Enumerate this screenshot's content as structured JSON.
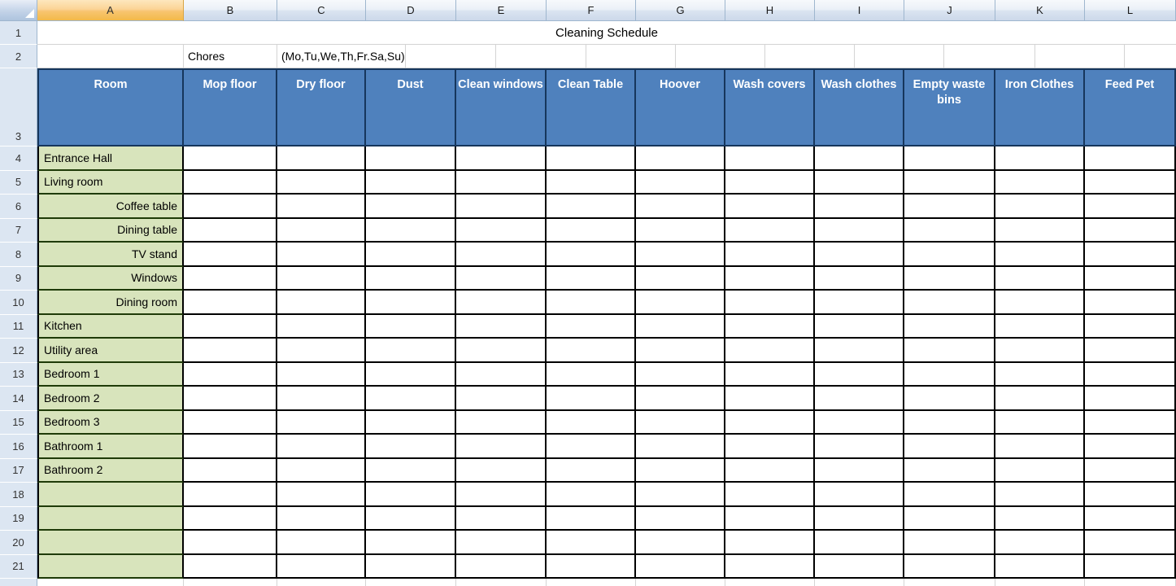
{
  "app": {
    "type": "spreadsheet"
  },
  "columns": {
    "labels": [
      "A",
      "B",
      "C",
      "D",
      "E",
      "F",
      "G",
      "H",
      "I",
      "J",
      "K",
      "L"
    ],
    "selected": "A"
  },
  "rows": {
    "numbers": [
      "1",
      "2",
      "3",
      "4",
      "5",
      "6",
      "7",
      "8",
      "9",
      "10",
      "11",
      "12",
      "13",
      "14",
      "15",
      "16",
      "17",
      "18",
      "19",
      "20",
      "21"
    ]
  },
  "title": {
    "text": "Cleaning Schedule"
  },
  "row2": {
    "b": "Chores",
    "c": "(Mo,Tu,We,Th,Fr.Sa,Su)"
  },
  "header": {
    "room_label": "Room",
    "chores": [
      "Mop floor",
      "Dry floor",
      "Dust",
      "Clean windows",
      "Clean Table",
      "Hoover",
      "Wash covers",
      "Wash clothes",
      "Empty waste bins",
      "Iron Clothes",
      "Feed Pet"
    ]
  },
  "rooms": [
    {
      "row": "4",
      "label": "Entrance Hall",
      "align": "left"
    },
    {
      "row": "5",
      "label": "Living room",
      "align": "left"
    },
    {
      "row": "6",
      "label": "Coffee table",
      "align": "right"
    },
    {
      "row": "7",
      "label": "Dining table",
      "align": "right"
    },
    {
      "row": "8",
      "label": "TV stand",
      "align": "right"
    },
    {
      "row": "9",
      "label": "Windows",
      "align": "right"
    },
    {
      "row": "10",
      "label": "Dining room",
      "align": "right"
    },
    {
      "row": "11",
      "label": "Kitchen",
      "align": "left"
    },
    {
      "row": "12",
      "label": "Utility area",
      "align": "left"
    },
    {
      "row": "13",
      "label": "Bedroom 1",
      "align": "left"
    },
    {
      "row": "14",
      "label": "Bedroom 2",
      "align": "left"
    },
    {
      "row": "15",
      "label": "Bedroom 3",
      "align": "left"
    },
    {
      "row": "16",
      "label": "Bathroom 1",
      "align": "left"
    },
    {
      "row": "17",
      "label": "Bathroom 2",
      "align": "left"
    },
    {
      "row": "18",
      "label": "",
      "align": "left"
    },
    {
      "row": "19",
      "label": "",
      "align": "left"
    },
    {
      "row": "20",
      "label": "",
      "align": "left"
    },
    {
      "row": "21",
      "label": "",
      "align": "left"
    }
  ],
  "colors": {
    "header_blue": "#4f81bd",
    "header_blue_border": "#16365c",
    "room_green": "#d8e4bc",
    "gutter_blue": "#dce6f2",
    "selected_col": "#f8c570"
  }
}
